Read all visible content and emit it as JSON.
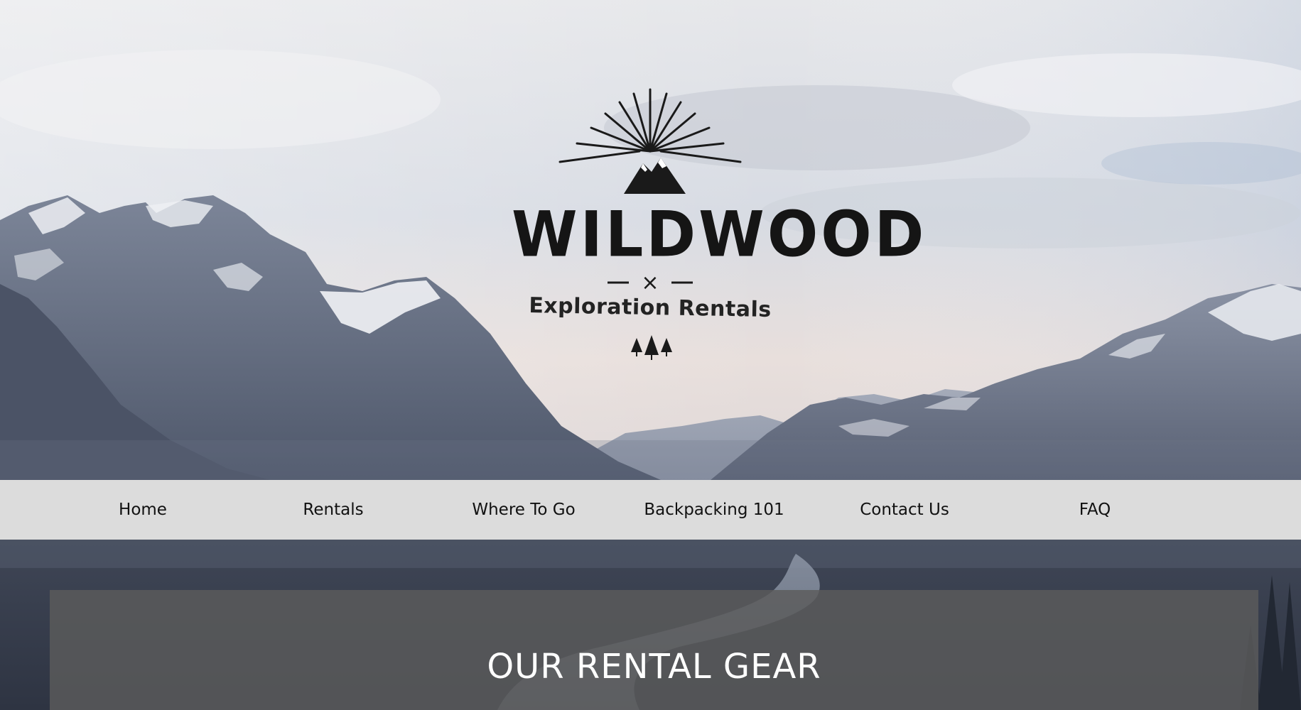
{
  "logo": {
    "icon": "mountain-sunburst-icon",
    "wordmark": "WILDWOOD",
    "divider_mark": "×",
    "tagline": "Exploration Rentals",
    "trees_icon": "three-pine-trees-icon"
  },
  "nav": {
    "items": [
      {
        "label": "Home"
      },
      {
        "label": "Rentals"
      },
      {
        "label": "Where To Go"
      },
      {
        "label": "Backpacking 101"
      },
      {
        "label": "Contact Us"
      },
      {
        "label": "FAQ"
      }
    ]
  },
  "main": {
    "section_title": "OUR RENTAL GEAR"
  },
  "colors": {
    "navbar_bg": "#dcdcdc",
    "panel_bg": "#5c5c5c",
    "logo_ink": "#151515",
    "title_text": "#ffffff"
  }
}
